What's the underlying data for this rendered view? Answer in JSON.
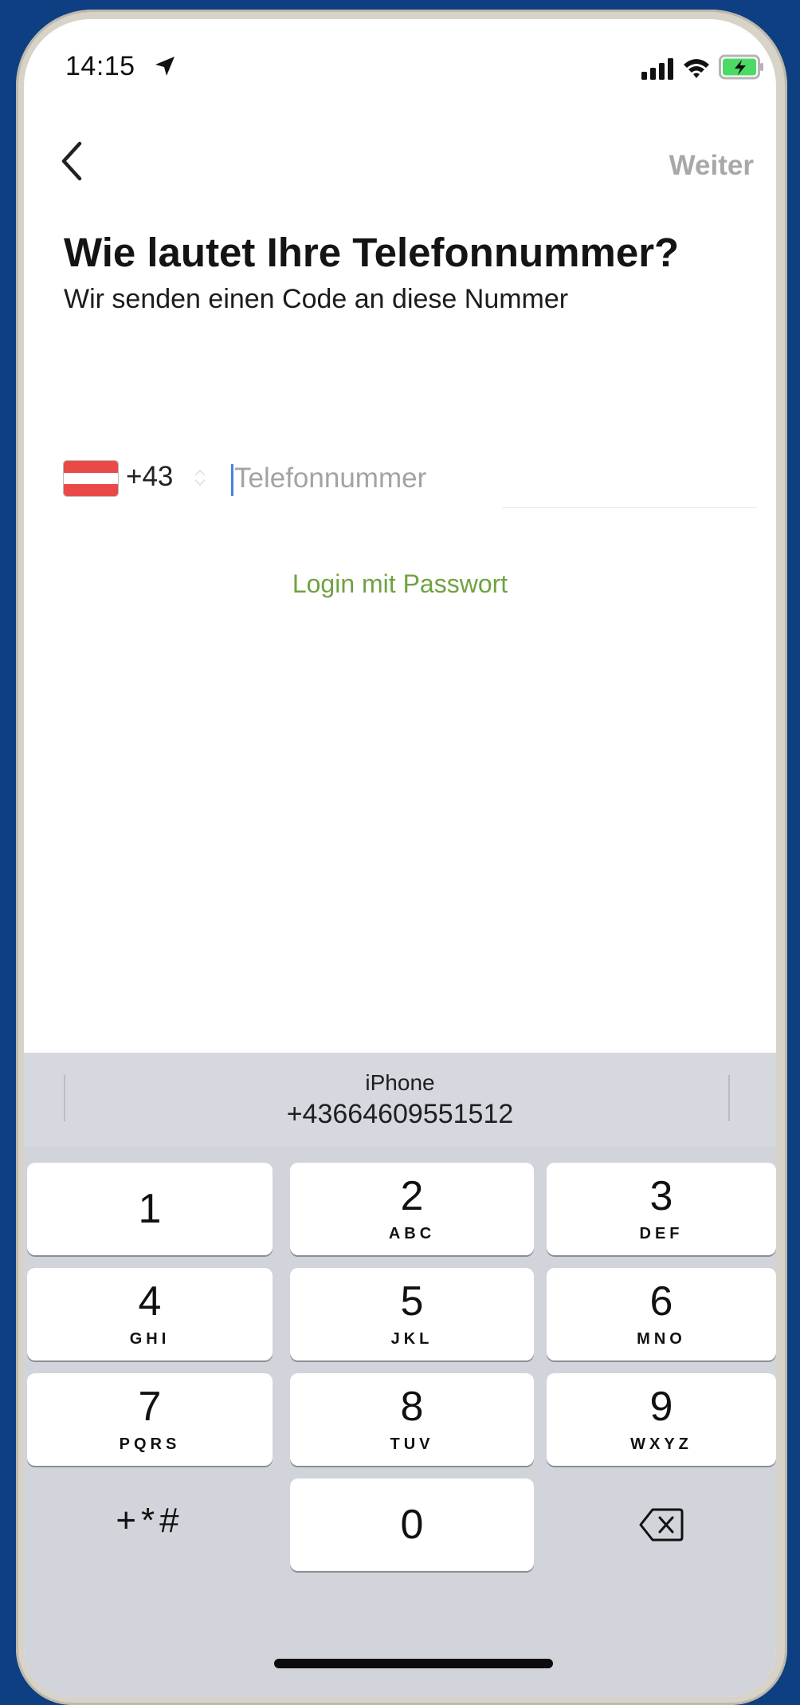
{
  "status_bar": {
    "time": "14:15",
    "location_icon": "location-arrow-icon",
    "signal_icon": "cellular-signal-icon",
    "wifi_icon": "wifi-icon",
    "battery_icon": "battery-charging-icon",
    "battery_color": "#4cd964"
  },
  "nav": {
    "back_icon": "chevron-left-icon",
    "next_label": "Weiter"
  },
  "heading": {
    "title": "Wie lautet Ihre Telefonnummer?",
    "subtitle": "Wir senden einen Code an diese Nummer"
  },
  "phone": {
    "country_flag": "austria-flag",
    "country_code": "+43",
    "placeholder": "Telefonnummer",
    "value": ""
  },
  "password_link": {
    "label": "Login mit Passwort",
    "color": "#6fa242"
  },
  "keyboard": {
    "suggestion": {
      "source": "iPhone",
      "number": "+43664609551512"
    },
    "keys": [
      {
        "digit": "1",
        "letters": ""
      },
      {
        "digit": "2",
        "letters": "ABC"
      },
      {
        "digit": "3",
        "letters": "DEF"
      },
      {
        "digit": "4",
        "letters": "GHI"
      },
      {
        "digit": "5",
        "letters": "JKL"
      },
      {
        "digit": "6",
        "letters": "MNO"
      },
      {
        "digit": "7",
        "letters": "PQRS"
      },
      {
        "digit": "8",
        "letters": "TUV"
      },
      {
        "digit": "9",
        "letters": "WXYZ"
      },
      {
        "digit": "0",
        "letters": ""
      }
    ],
    "symbols_label": "+*#",
    "delete_icon": "backspace-icon"
  }
}
